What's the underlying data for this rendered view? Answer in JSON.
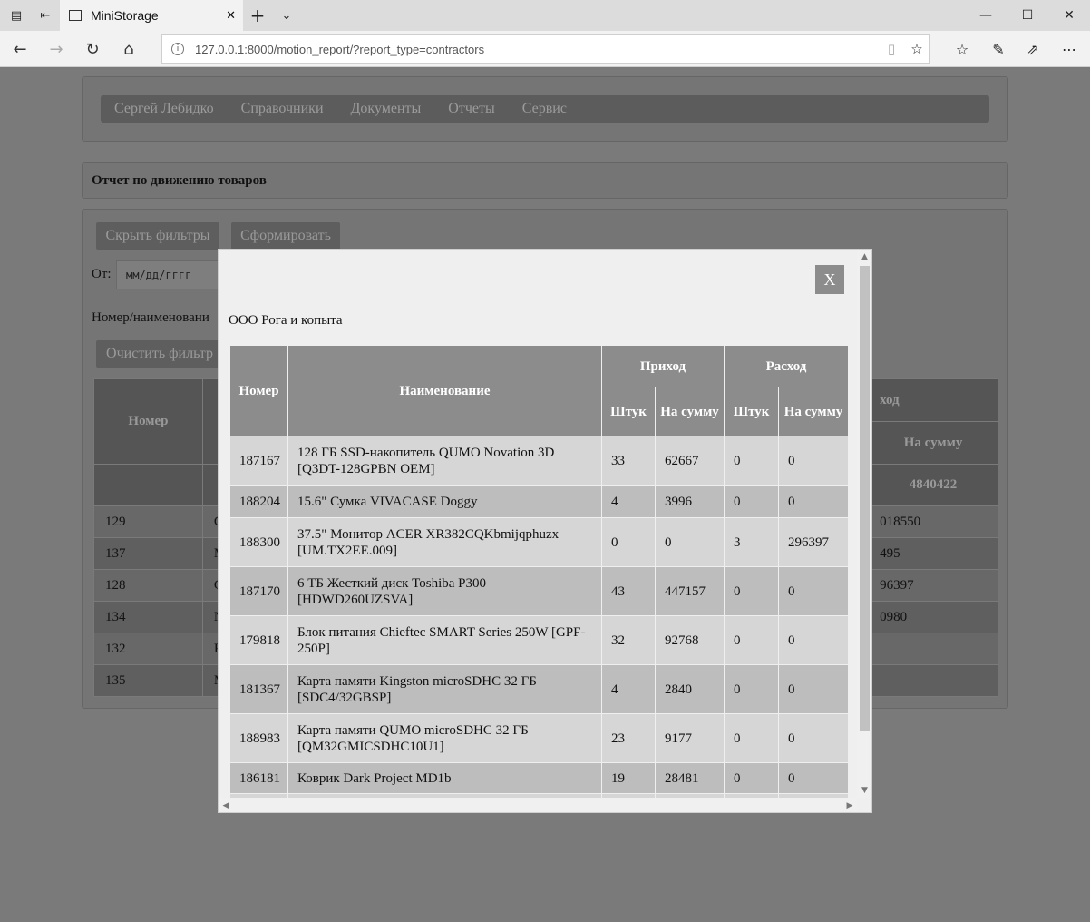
{
  "browser": {
    "tab_title": "MiniStorage",
    "url": "127.0.0.1:8000/motion_report/?report_type=contractors",
    "icons": [
      "back-arrow-icon",
      "forward-arrow-icon",
      "refresh-icon",
      "home-icon",
      "reading-view-icon",
      "favorite-star-icon",
      "favorites-list-icon",
      "notes-pen-icon",
      "share-icon",
      "more-icon"
    ]
  },
  "menu": {
    "items": [
      "Сергей Лебидко",
      "Справочники",
      "Документы",
      "Отчеты",
      "Сервис"
    ]
  },
  "report": {
    "title": "Отчет по движению товаров",
    "hide_filters_label": "Скрыть фильтры",
    "generate_label": "Сформировать",
    "from_label": "От:",
    "date_placeholder": "мм/дд/гггг",
    "name_filter_label": "Номер/наименовани",
    "clear_filters_label": "Очистить фильтр"
  },
  "background_table": {
    "header_number": "Номер",
    "header_expense_fragment": "ход",
    "header_sum": "На сумму",
    "total_sum": "4840422",
    "rows": [
      {
        "number": "129",
        "name_fragment": "С",
        "sum_fragment": "018550"
      },
      {
        "number": "137",
        "name_fragment": "М",
        "sum_fragment": "495"
      },
      {
        "number": "128",
        "name_fragment": "С",
        "sum_fragment": "96397"
      },
      {
        "number": "134",
        "name_fragment": "N",
        "sum_fragment": "0980"
      },
      {
        "number": "132",
        "name_fragment": "Р",
        "sum_fragment": ""
      },
      {
        "number": "135",
        "name_fragment": "М",
        "sum_fragment": ""
      }
    ]
  },
  "modal": {
    "close_label": "X",
    "contractor": "ООО Рога и копыта",
    "headers": {
      "number": "Номер",
      "name": "Наименование",
      "income": "Приход",
      "expense": "Расход",
      "qty": "Штук",
      "sum": "На сумму"
    },
    "rows": [
      {
        "number": "187167",
        "name": "128 ГБ SSD-накопитель QUMO Novation 3D [Q3DT-128GPBN OEM]",
        "in_qty": "33",
        "in_sum": "62667",
        "out_qty": "0",
        "out_sum": "0"
      },
      {
        "number": "188204",
        "name": "15.6\" Сумка VIVACASE Doggy",
        "in_qty": "4",
        "in_sum": "3996",
        "out_qty": "0",
        "out_sum": "0"
      },
      {
        "number": "188300",
        "name": "37.5\" Монитор ACER XR382CQKbmijqphuzx [UM.TX2EE.009]",
        "in_qty": "0",
        "in_sum": "0",
        "out_qty": "3",
        "out_sum": "296397"
      },
      {
        "number": "187170",
        "name": "6 ТБ Жесткий диск Toshiba P300 [HDWD260UZSVA]",
        "in_qty": "43",
        "in_sum": "447157",
        "out_qty": "0",
        "out_sum": "0"
      },
      {
        "number": "179818",
        "name": "Блок питания Chieftec SMART Series 250W [GPF-250P]",
        "in_qty": "32",
        "in_sum": "92768",
        "out_qty": "0",
        "out_sum": "0"
      },
      {
        "number": "181367",
        "name": "Карта памяти Kingston microSDHC 32 ГБ [SDC4/32GBSP]",
        "in_qty": "4",
        "in_sum": "2840",
        "out_qty": "0",
        "out_sum": "0"
      },
      {
        "number": "188983",
        "name": "Карта памяти QUMO microSDHC 32 ГБ [QM32GMICSDHC10U1]",
        "in_qty": "23",
        "in_sum": "9177",
        "out_qty": "0",
        "out_sum": "0"
      },
      {
        "number": "186181",
        "name": "Коврик Dark Project MD1b",
        "in_qty": "19",
        "in_sum": "28481",
        "out_qty": "0",
        "out_sum": "0"
      }
    ]
  }
}
